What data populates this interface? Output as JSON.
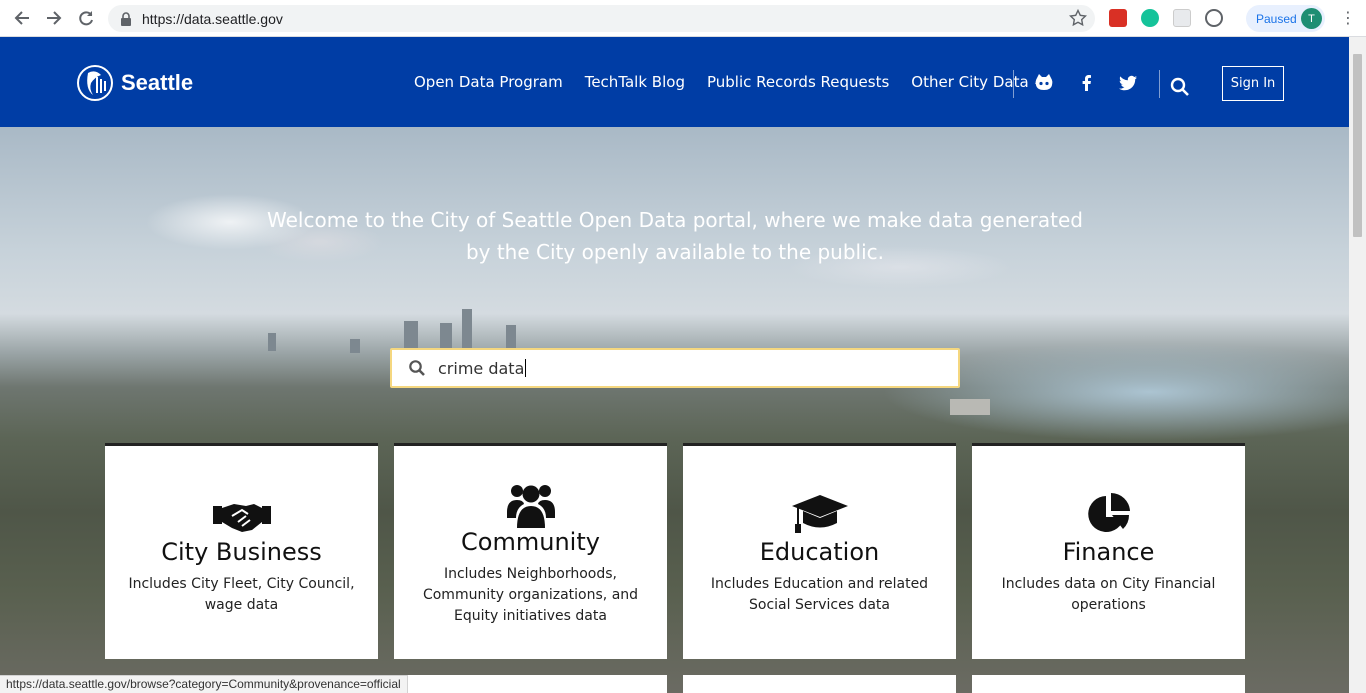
{
  "browser": {
    "url": "https://data.seattle.gov",
    "profile_status": "Paused",
    "profile_initial": "T"
  },
  "header": {
    "logo_text": "Seattle",
    "nav": [
      {
        "label": "Open Data Program"
      },
      {
        "label": "TechTalk Blog"
      },
      {
        "label": "Public Records Requests"
      },
      {
        "label": "Other City Data"
      }
    ],
    "sign_in": "Sign In"
  },
  "hero": {
    "tagline": "Welcome to the City of Seattle Open Data portal, where we make data generated by the City openly available to the public.",
    "search_value": "crime data"
  },
  "categories": [
    {
      "title": "City Business",
      "description": "Includes City Fleet, City Council, wage data",
      "icon": "handshake-icon"
    },
    {
      "title": "Community",
      "description": "Includes Neighborhoods, Community organizations, and Equity initiatives data",
      "icon": "users-icon"
    },
    {
      "title": "Education",
      "description": "Includes Education and related Social Services data",
      "icon": "graduation-cap-icon"
    },
    {
      "title": "Finance",
      "description": "Includes data on City Financial operations",
      "icon": "pie-chart-icon"
    }
  ],
  "status_bar": {
    "text": "https://data.seattle.gov/browse?category=Community&provenance=official"
  },
  "colors": {
    "header_bg": "#003da5",
    "search_border": "#f5d77f"
  }
}
